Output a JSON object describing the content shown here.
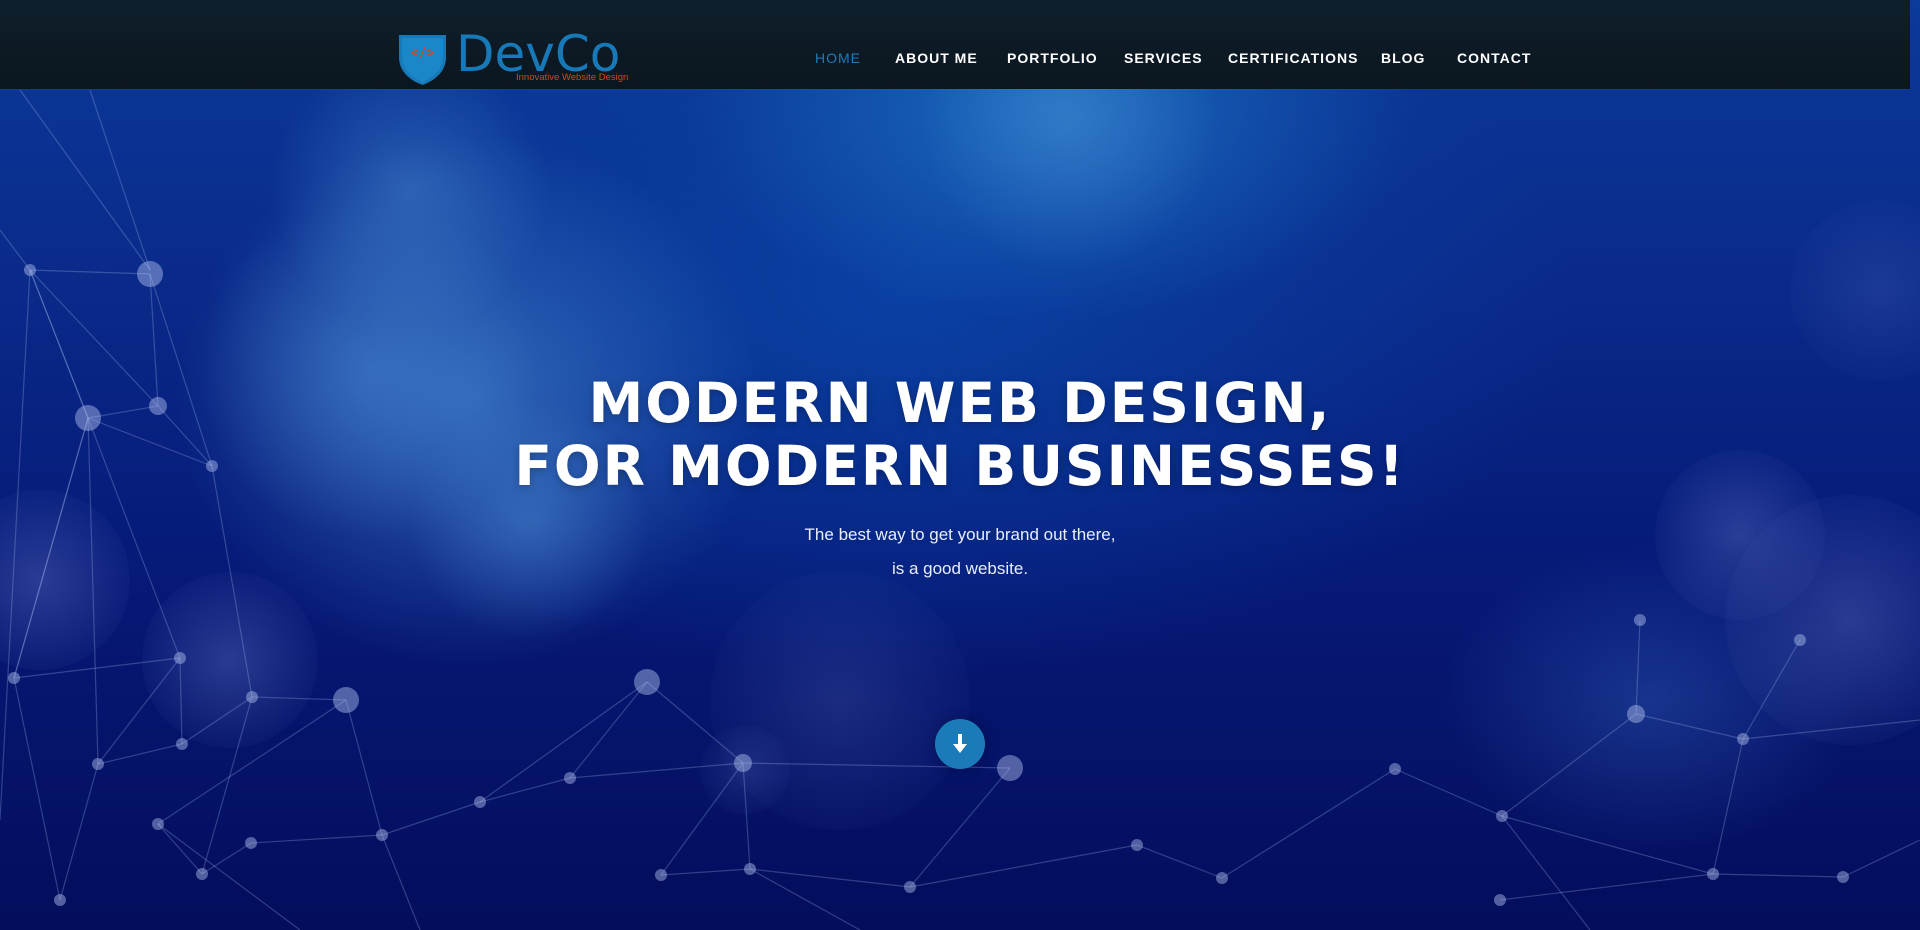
{
  "brand": {
    "name": "DevCo",
    "tagline": "Innovative Website Design",
    "shield_icon": "code-shield-icon",
    "color": "#1879b8",
    "tagline_color": "#d24a1c"
  },
  "nav": {
    "items": [
      {
        "label": "HOME",
        "active": true
      },
      {
        "label": "ABOUT ME",
        "active": false
      },
      {
        "label": "PORTFOLIO",
        "active": false
      },
      {
        "label": "SERVICES",
        "active": false
      },
      {
        "label": "CERTIFICATIONS",
        "active": false
      },
      {
        "label": "BLOG",
        "active": false
      },
      {
        "label": "CONTACT",
        "active": false
      }
    ],
    "active_color": "#1e7bb8"
  },
  "hero": {
    "title_line1": "MODERN WEB DESIGN,",
    "title_line2": "FOR MODERN BUSINESSES!",
    "subtitle_line1": "The best way to get your brand out there,",
    "subtitle_line2": "is a good website.",
    "scroll_icon": "arrow-down-icon",
    "accent_color": "#1a7bb8"
  }
}
